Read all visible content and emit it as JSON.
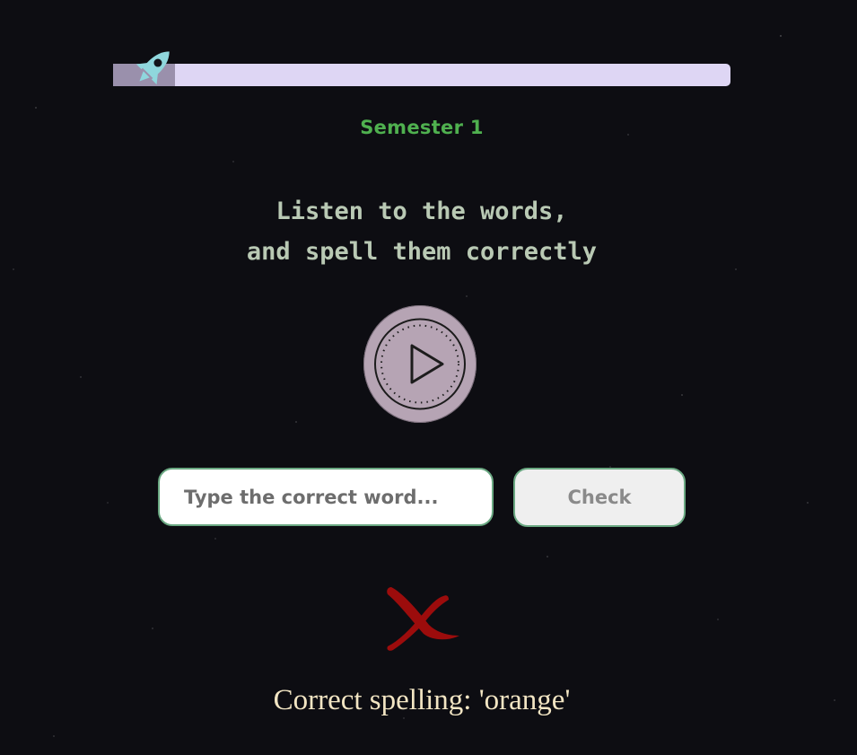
{
  "progress": {
    "fraction": 0.1,
    "track_color": "#ded6f4",
    "fill_color": "#9a90ac",
    "marker_icon": "rocket-icon"
  },
  "quiz": {
    "semester_label": "Semester 1",
    "instruction_line1": "Listen to the words,",
    "instruction_line2": "and spell them correctly",
    "play_icon": "play-icon"
  },
  "answer": {
    "placeholder": "Type the correct word...",
    "value": "",
    "check_label": "Check"
  },
  "feedback": {
    "status": "incorrect",
    "status_icon": "red-x-icon",
    "status_color": "#9c0c0c",
    "correct_spelling_text": "Correct spelling: 'orange'"
  }
}
